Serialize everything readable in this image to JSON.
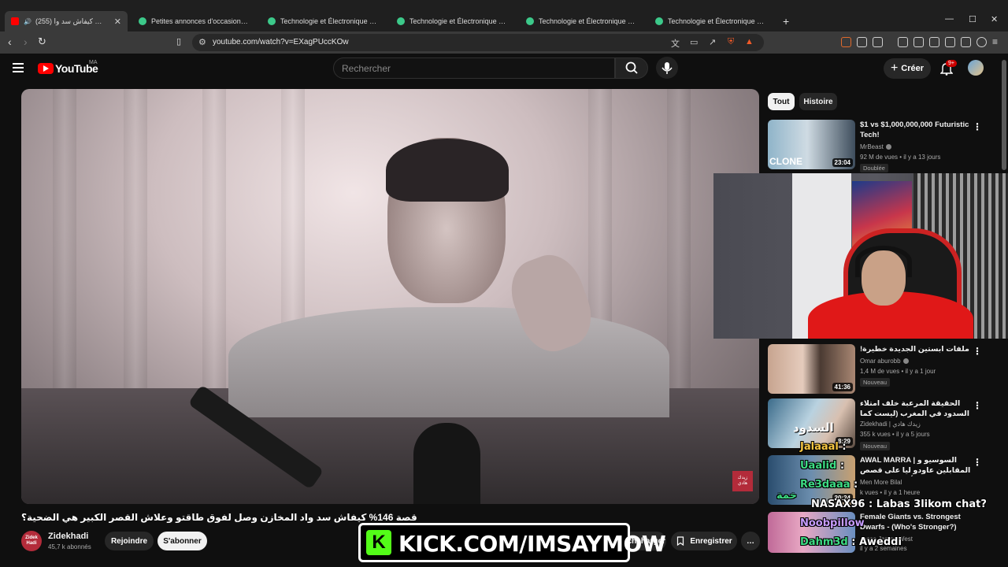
{
  "browser": {
    "tabs": [
      {
        "label": "(255) قصة 146% كيفاش سد وا",
        "active": true
      },
      {
        "label": "Petites annonces d'occasion, gratuite"
      },
      {
        "label": "Technologie et Électronique d'Occas"
      },
      {
        "label": "Technologie et Électronique d'Occas"
      },
      {
        "label": "Technologie et Électronique d'Occas"
      },
      {
        "label": "Technologie et Électronique d'Occas"
      }
    ],
    "new_tab": "+",
    "url": "youtube.com/watch?v=EXagPUccKOw"
  },
  "header": {
    "logo_text": "YouTube",
    "country_code": "MA",
    "search_placeholder": "Rechercher",
    "create_label": "Créer",
    "notification_count": "9+"
  },
  "video": {
    "title": "قصة 146% كيفاش سد واد المخازن وصل لفوق طاقتو وعلاش القصر الكبير هي الضحية؟",
    "channel": "Zidekhadi",
    "subscribers": "45,7 k abonnés",
    "channel_avatar_text": "Zidek Hadi",
    "watermark_text": "زيدك هادي",
    "join_label": "Rejoindre",
    "subscribe_label": "S'abonner",
    "download_label": "échcharger",
    "save_label": "Enregistrer",
    "more_label": "…"
  },
  "overlay": {
    "kick_logo": "K",
    "kick_text": "KICK.COM/IMSAYMOW"
  },
  "chips": {
    "all": "Tout",
    "history": "Histoire"
  },
  "recommendations": [
    {
      "title": "$1 vs $1,000,000,000 Futuristic Tech!",
      "channel": "MrBeast",
      "meta": "92 M de vues • il y a 13 jours",
      "duration": "23:04",
      "badge": "Doublée",
      "thumb_label": "CLONE"
    },
    {
      "title": "ملفات ابستين الجديدة خطيرة!",
      "channel": "Omar aburobb",
      "meta": "1,4 M de vues • il y a 1 jour",
      "duration": "41:36",
      "badge": "Nouveau"
    },
    {
      "title": "الحقيقة المرعبة خلف امتلاء السدود في المغرب (ليست كما تظن!)",
      "channel": "Zidekhadi | زيدك هادي",
      "meta": "355 k vues • il y a 5 jours",
      "duration": "8:29",
      "badge": "Nouveau",
      "thumb_label": "السدود"
    },
    {
      "title": "AWAL MARRA | السوسيو و المقابلين عاودو ليا على قصص أول خدمة ليهم",
      "channel": "Men More Bilal",
      "meta": "k vues • il y a 1 heure",
      "duration": "20:24"
    },
    {
      "title": "Female Giants vs. Strongest Dwarfs - (Who's Stronger?)",
      "channel": "Jesse James West",
      "meta": "il y a 2 semaines",
      "duration": ""
    }
  ],
  "chat": [
    {
      "user": "Jalaaal",
      "message": ""
    },
    {
      "user": "Uaalid",
      "message": ""
    },
    {
      "user": "Re3daaa",
      "message": ""
    },
    {
      "user": "",
      "message": "خمة"
    },
    {
      "user": "NASAX96",
      "message": "Labas 3likom chat?"
    },
    {
      "user": "Noobpillow",
      "message": ""
    },
    {
      "user": "Dahm3d",
      "message": "Aweddi"
    }
  ]
}
